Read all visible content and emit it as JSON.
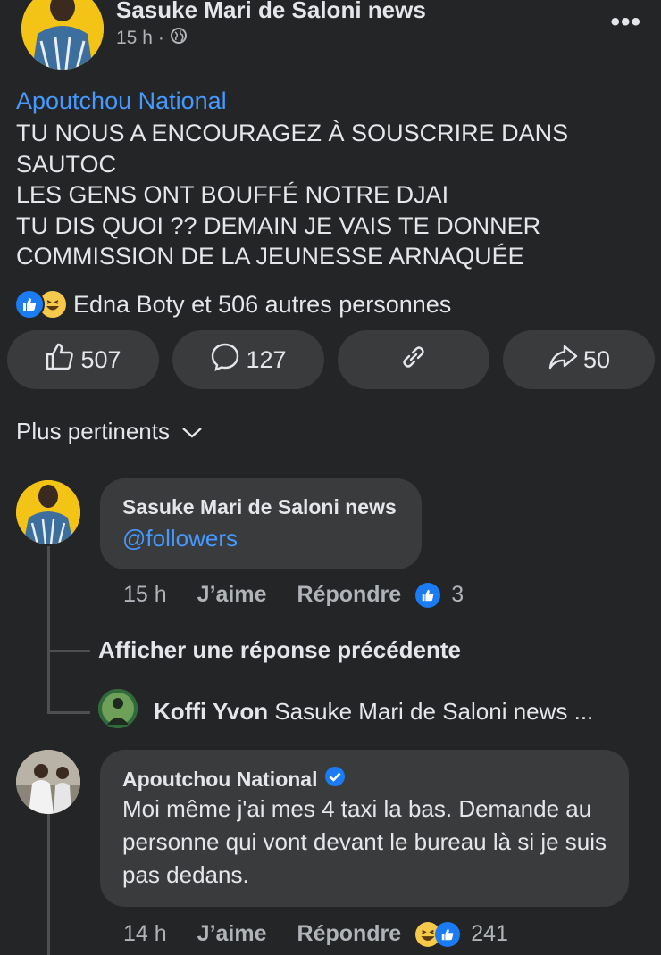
{
  "post": {
    "author": "Sasuke Mari de Saloni news",
    "time": "15 h",
    "mention": "Apoutchou National",
    "text": "TU NOUS A ENCOURAGEZ À SOUSCRIRE DANS\nSAUTOC\nLES GENS ONT BOUFFÉ NOTRE DJAI\nTU DIS QUOI ?? DEMAIN JE VAIS TE DONNER\nCOMMISSION DE LA JEUNESSE ARNAQUÉE"
  },
  "reactions": {
    "summary": "Edna Boty et 506 autres personnes"
  },
  "actions": {
    "like_count": "507",
    "comment_count": "127",
    "share_count": "50"
  },
  "sort": {
    "label": "Plus pertinents"
  },
  "comments": [
    {
      "author": "Sasuke Mari de Saloni news",
      "text": "@followers",
      "time": "15 h",
      "like_label": "J’aime",
      "reply_label": "Répondre",
      "reaction_count": "3"
    },
    {
      "author": "Apoutchou National",
      "text": "Moi même j'ai mes 4 taxi la bas. Demande au personne qui vont devant le bureau là si je suis pas dedans.",
      "time": "14 h",
      "like_label": "J’aime",
      "reply_label": "Répondre",
      "reaction_count": "241"
    }
  ],
  "thread": {
    "show_previous": "Afficher une réponse précédente",
    "reply_author": "Koffi Yvon",
    "reply_preview": "Sasuke Mari de Saloni news ..."
  },
  "colors": {
    "background": "#242526",
    "bubble": "#3a3b3c",
    "link": "#4599ff",
    "like_blue": "#1a7bf2"
  }
}
